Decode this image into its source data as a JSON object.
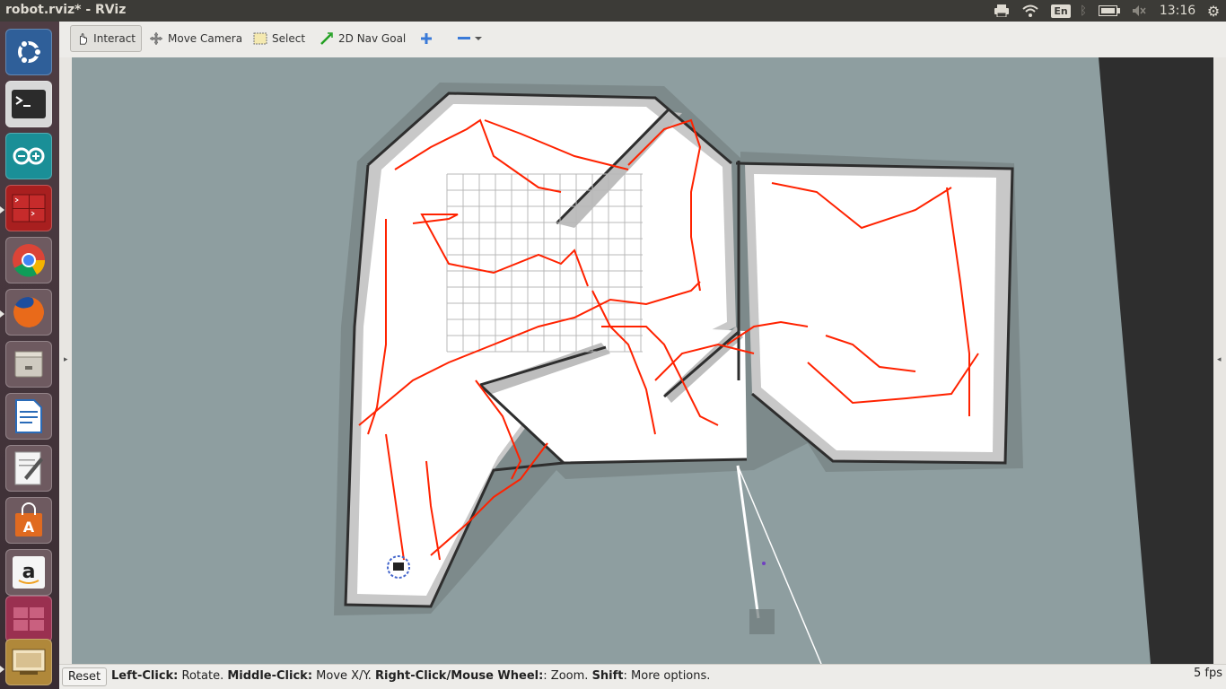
{
  "window": {
    "title": "robot.rviz* - RViz"
  },
  "panel": {
    "clock": "13:16",
    "keyboard_layout": "En",
    "indicators": [
      "printer-icon",
      "wifi-icon",
      "keyboard-layout-indicator",
      "bluetooth-icon",
      "battery-icon",
      "volume-muted-icon",
      "clock",
      "system-gear-icon"
    ]
  },
  "launcher": {
    "items": [
      {
        "name": "ubuntu-dash",
        "icon": "ubuntu-logo-icon",
        "color": "#3a6ea5"
      },
      {
        "name": "terminal",
        "icon": "terminal-icon",
        "color": "#2c2c2c"
      },
      {
        "name": "arduino",
        "icon": "arduino-icon",
        "color": "#1a8f97"
      },
      {
        "name": "terminator",
        "icon": "terminator-icon",
        "color": "#b52a2a"
      },
      {
        "name": "chrome",
        "icon": "chrome-icon",
        "color": "#e8e8e8"
      },
      {
        "name": "firefox",
        "icon": "firefox-icon",
        "color": "#e96a1a"
      },
      {
        "name": "files",
        "icon": "file-cabinet-icon",
        "color": "#cfcac0"
      },
      {
        "name": "libreoffice-writer",
        "icon": "document-icon",
        "color": "#2a6bb8"
      },
      {
        "name": "text-editor",
        "icon": "text-editor-icon",
        "color": "#e6e6e6"
      },
      {
        "name": "software-center",
        "icon": "shopping-bag-icon",
        "color": "#e06a20"
      },
      {
        "name": "amazon",
        "icon": "amazon-icon",
        "color": "#f0f0f0"
      },
      {
        "name": "workspace-switcher",
        "icon": "workspace-icon",
        "color": "#b03a5a"
      },
      {
        "name": "rviz-app",
        "icon": "rviz-icon",
        "color": "#c89b3a"
      }
    ]
  },
  "toolbar": {
    "interact": "Interact",
    "move_camera": "Move Camera",
    "select": "Select",
    "nav_goal": "2D Nav Goal"
  },
  "status": {
    "reset": "Reset",
    "left_click_key": "Left-Click:",
    "left_click_val": " Rotate. ",
    "middle_click_key": "Middle-Click:",
    "middle_click_val": " Move X/Y. ",
    "right_click_key": "Right-Click/Mouse Wheel:",
    "right_click_val": ": Zoom. ",
    "shift_key": "Shift",
    "shift_val": ": More options.",
    "fps": "5 fps"
  },
  "viewport": {
    "background_color": "#8e9ea0",
    "map_free_color": "#ffffff",
    "map_unknown_color": "#9aa5a5",
    "wall_color": "#333333",
    "path_color": "#ff2200"
  }
}
